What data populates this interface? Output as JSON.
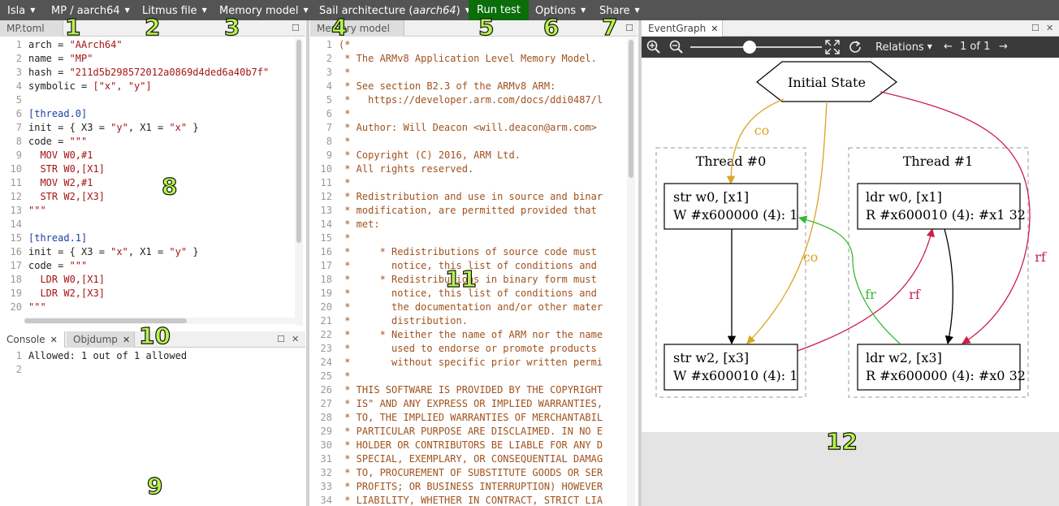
{
  "menu": {
    "isla": "Isla",
    "arch": "MP / aarch64",
    "litmus": "Litmus file",
    "memory": "Memory model",
    "sail_prefix": "Sail architecture (",
    "sail_arch": "aarch64",
    "sail_suffix": ")",
    "run": "Run test",
    "options": "Options",
    "share": "Share"
  },
  "callouts": [
    "1",
    "2",
    "3",
    "4",
    "5",
    "6",
    "7",
    "8",
    "9",
    "10",
    "11",
    "12"
  ],
  "litmus_pane": {
    "tab": "MP.toml",
    "lines": [
      {
        "n": "1",
        "parts": [
          [
            "arch = ",
            ""
          ],
          [
            "\"AArch64\"",
            "str"
          ]
        ]
      },
      {
        "n": "2",
        "parts": [
          [
            "name = ",
            ""
          ],
          [
            "\"MP\"",
            "str"
          ]
        ]
      },
      {
        "n": "3",
        "parts": [
          [
            "hash = ",
            ""
          ],
          [
            "\"211d5b298572012a0869d4ded6a40b7f\"",
            "str"
          ]
        ]
      },
      {
        "n": "4",
        "parts": [
          [
            "symbolic = ",
            ""
          ],
          [
            "[\"x\", \"y\"]",
            "str"
          ]
        ]
      },
      {
        "n": "5",
        "parts": []
      },
      {
        "n": "6",
        "parts": [
          [
            "[thread.0]",
            "sec"
          ]
        ]
      },
      {
        "n": "7",
        "parts": [
          [
            "init = { X3 = ",
            ""
          ],
          [
            "\"y\"",
            "str"
          ],
          [
            ", X1 = ",
            ""
          ],
          [
            "\"x\"",
            "str"
          ],
          [
            " }",
            ""
          ]
        ]
      },
      {
        "n": "8",
        "parts": [
          [
            "code = ",
            ""
          ],
          [
            "\"\"\"",
            "str"
          ]
        ]
      },
      {
        "n": "9",
        "parts": [
          [
            "  MOV W0,#1",
            "str"
          ]
        ]
      },
      {
        "n": "10",
        "parts": [
          [
            "  STR W0,[X1]",
            "str"
          ]
        ]
      },
      {
        "n": "11",
        "parts": [
          [
            "  MOV W2,#1",
            "str"
          ]
        ]
      },
      {
        "n": "12",
        "parts": [
          [
            "  STR W2,[X3]",
            "str"
          ]
        ]
      },
      {
        "n": "13",
        "parts": [
          [
            "\"\"\"",
            "str"
          ]
        ]
      },
      {
        "n": "14",
        "parts": []
      },
      {
        "n": "15",
        "parts": [
          [
            "[thread.1]",
            "sec"
          ]
        ]
      },
      {
        "n": "16",
        "parts": [
          [
            "init = { X3 = ",
            ""
          ],
          [
            "\"x\"",
            "str"
          ],
          [
            ", X1 = ",
            ""
          ],
          [
            "\"y\"",
            "str"
          ],
          [
            " }",
            ""
          ]
        ]
      },
      {
        "n": "17",
        "parts": [
          [
            "code = ",
            ""
          ],
          [
            "\"\"\"",
            "str"
          ]
        ]
      },
      {
        "n": "18",
        "parts": [
          [
            "  LDR W0,[X1]",
            "str"
          ]
        ]
      },
      {
        "n": "19",
        "parts": [
          [
            "  LDR W2,[X3]",
            "str"
          ]
        ]
      },
      {
        "n": "20",
        "parts": [
          [
            "\"\"\"",
            "str"
          ]
        ]
      }
    ]
  },
  "console_pane": {
    "tabs": [
      "Console",
      "Objdump"
    ],
    "lines": [
      {
        "n": "1",
        "text": "Allowed: 1 out of 1 allowed"
      },
      {
        "n": "2",
        "text": ""
      }
    ]
  },
  "memory_pane": {
    "tab": "Memory model",
    "lines": [
      {
        "n": "1",
        "text": "(*"
      },
      {
        "n": "2",
        "text": " * The ARMv8 Application Level Memory Model."
      },
      {
        "n": "3",
        "text": " *"
      },
      {
        "n": "4",
        "text": " * See section B2.3 of the ARMv8 ARM:"
      },
      {
        "n": "5",
        "text": " *   https://developer.arm.com/docs/ddi0487/l"
      },
      {
        "n": "6",
        "text": " *"
      },
      {
        "n": "7",
        "text": " * Author: Will Deacon <will.deacon@arm.com>"
      },
      {
        "n": "8",
        "text": " *"
      },
      {
        "n": "9",
        "text": " * Copyright (C) 2016, ARM Ltd."
      },
      {
        "n": "10",
        "text": " * All rights reserved."
      },
      {
        "n": "11",
        "text": " *"
      },
      {
        "n": "12",
        "text": " * Redistribution and use in source and binar"
      },
      {
        "n": "13",
        "text": " * modification, are permitted provided that"
      },
      {
        "n": "14",
        "text": " * met:"
      },
      {
        "n": "15",
        "text": " *"
      },
      {
        "n": "16",
        "text": " *     * Redistributions of source code must"
      },
      {
        "n": "17",
        "text": " *       notice, this list of conditions and"
      },
      {
        "n": "18",
        "text": " *     * Redistributions in binary form must"
      },
      {
        "n": "19",
        "text": " *       notice, this list of conditions and"
      },
      {
        "n": "20",
        "text": " *       the documentation and/or other mater"
      },
      {
        "n": "21",
        "text": " *       distribution."
      },
      {
        "n": "22",
        "text": " *     * Neither the name of ARM nor the name"
      },
      {
        "n": "23",
        "text": " *       used to endorse or promote products"
      },
      {
        "n": "24",
        "text": " *       without specific prior written permi"
      },
      {
        "n": "25",
        "text": " *"
      },
      {
        "n": "26",
        "text": " * THIS SOFTWARE IS PROVIDED BY THE COPYRIGHT"
      },
      {
        "n": "27",
        "text": " * IS\" AND ANY EXPRESS OR IMPLIED WARRANTIES,"
      },
      {
        "n": "28",
        "text": " * TO, THE IMPLIED WARRANTIES OF MERCHANTABIL"
      },
      {
        "n": "29",
        "text": " * PARTICULAR PURPOSE ARE DISCLAIMED. IN NO E"
      },
      {
        "n": "30",
        "text": " * HOLDER OR CONTRIBUTORS BE LIABLE FOR ANY D"
      },
      {
        "n": "31",
        "text": " * SPECIAL, EXEMPLARY, OR CONSEQUENTIAL DAMAG"
      },
      {
        "n": "32",
        "text": " * TO, PROCUREMENT OF SUBSTITUTE GOODS OR SER"
      },
      {
        "n": "33",
        "text": " * PROFITS; OR BUSINESS INTERRUPTION) HOWEVER"
      },
      {
        "n": "34",
        "text": " * LIABILITY, WHETHER IN CONTRACT, STRICT LIA"
      }
    ]
  },
  "graph_pane": {
    "tab": "EventGraph",
    "relations_label": "Relations",
    "page_label": "1 of 1",
    "zoom_level": 0.45,
    "initial_state": "Initial State",
    "thread0_label": "Thread #0",
    "thread1_label": "Thread #1",
    "events": {
      "t0_e0": {
        "instr": "str w0, [x1]",
        "access": "W #x600000 (4): 1"
      },
      "t0_e1": {
        "instr": "str w2, [x3]",
        "access": "W #x600010 (4): 1"
      },
      "t1_e0": {
        "instr": "ldr w0, [x1]",
        "access": "R #x600010 (4): #x1 32"
      },
      "t1_e1": {
        "instr": "ldr w2, [x3]",
        "access": "R #x600000 (4): #x0 32"
      }
    },
    "edge_labels": {
      "co1": "co",
      "co2": "co",
      "fr": "fr",
      "rf1": "rf",
      "rf2": "rf"
    },
    "colors": {
      "co": "#daa520",
      "rf": "#cc1f4a",
      "fr": "#33bb33",
      "po": "#000000"
    }
  }
}
